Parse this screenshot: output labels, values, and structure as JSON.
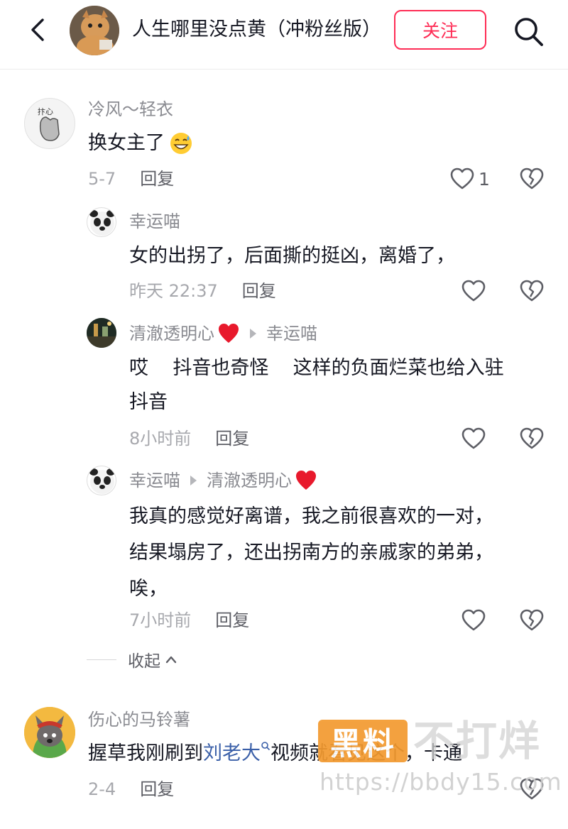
{
  "header": {
    "channel_title": "人生哪里没点黄（冲粉丝版）",
    "follow_label": "关注"
  },
  "comments": [
    {
      "username": "冷风～轻衣",
      "avatar_text": "抃心",
      "text": "换女主了",
      "emoji": "grinning-sweat-emoji",
      "date": "5-7",
      "reply_label": "回复",
      "like_count": "1"
    },
    {
      "username": "幸运喵",
      "text": "女的出拐了，后面撕的挺凶，离婚了，",
      "date": "昨天 22:37",
      "reply_label": "回复"
    },
    {
      "username": "清澈透明心",
      "reply_to": "幸运喵",
      "text_line1": "哎    抖音也奇怪    这样的负面烂菜也给入驻",
      "text_line2": "抖音",
      "date": "8小时前",
      "reply_label": "回复"
    },
    {
      "username": "幸运喵",
      "reply_to": "清澈透明心",
      "text_line1": "我真的感觉好离谱，我之前很喜欢的一对，",
      "text_line2": "结果塌房了，还出拐南方的亲戚家的弟弟，",
      "text_line3": "唉，",
      "date": "7小时前",
      "reply_label": "回复"
    },
    {
      "username": "伤心的马铃薯",
      "text_before": "握草我刚刷到",
      "mention": "刘老大",
      "text_after": "视频就看见这个，卡通",
      "date": "2-4",
      "reply_label": "回复"
    }
  ],
  "collapse_label": "收起",
  "watermark": {
    "box_text": "黑料",
    "big_text": "不打烊",
    "url": "https://bbdy15.com"
  },
  "colors": {
    "accent": "#fe2c55",
    "username": "#8a8b91",
    "text": "#161823",
    "meta": "#a7a8ad",
    "mention": "#3a5fa8"
  }
}
